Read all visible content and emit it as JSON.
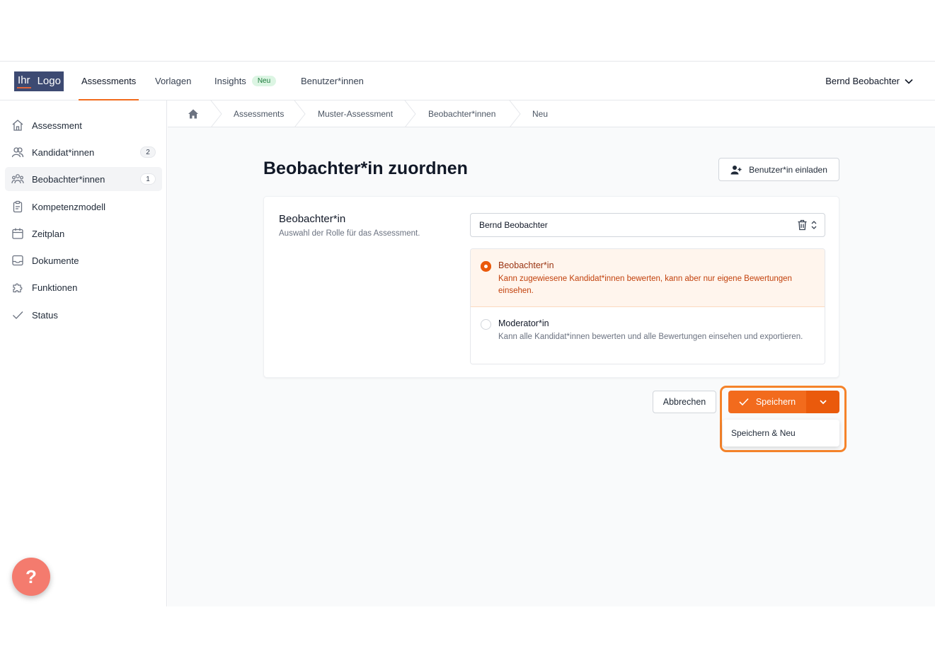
{
  "logo": {
    "part1": "Ihr",
    "part2": "Logo"
  },
  "nav": {
    "items": [
      {
        "label": "Assessments"
      },
      {
        "label": "Vorlagen"
      },
      {
        "label": "Insights",
        "badge": "Neu"
      },
      {
        "label": "Benutzer*innen"
      }
    ],
    "user": "Bernd Beobachter"
  },
  "sidebar": {
    "items": [
      {
        "label": "Assessment",
        "icon": "home-icon"
      },
      {
        "label": "Kandidat*innen",
        "icon": "users-icon",
        "count": "2"
      },
      {
        "label": "Beobachter*innen",
        "icon": "user-group-icon",
        "count": "1"
      },
      {
        "label": "Kompetenzmodell",
        "icon": "clipboard-icon"
      },
      {
        "label": "Zeitplan",
        "icon": "calendar-icon"
      },
      {
        "label": "Dokumente",
        "icon": "inbox-icon"
      },
      {
        "label": "Funktionen",
        "icon": "puzzle-icon"
      },
      {
        "label": "Status",
        "icon": "check-icon"
      }
    ],
    "help": "?"
  },
  "breadcrumb": [
    "Assessments",
    "Muster-Assessment",
    "Beobachter*innen",
    "Neu"
  ],
  "page": {
    "title": "Beobachter*in zuordnen",
    "invite_label": "Benutzer*in einladen"
  },
  "form": {
    "field_title": "Beobachter*in",
    "field_desc": "Auswahl der Rolle für das Assessment.",
    "selected_user": "Bernd Beobachter",
    "roles": [
      {
        "title": "Beobachter*in",
        "desc": "Kann zugewiesene Kandidat*innen bewerten, kann aber nur eigene Bewertungen einsehen.",
        "selected": true
      },
      {
        "title": "Moderator*in",
        "desc": "Kann alle Kandidat*innen bewerten und alle Bewertungen einsehen und exportieren.",
        "selected": false
      }
    ]
  },
  "actions": {
    "cancel": "Abbrechen",
    "save": "Speichern",
    "save_new": "Speichern & Neu"
  },
  "colors": {
    "accent": "#f26b1d",
    "highlight": "#f5832a"
  }
}
